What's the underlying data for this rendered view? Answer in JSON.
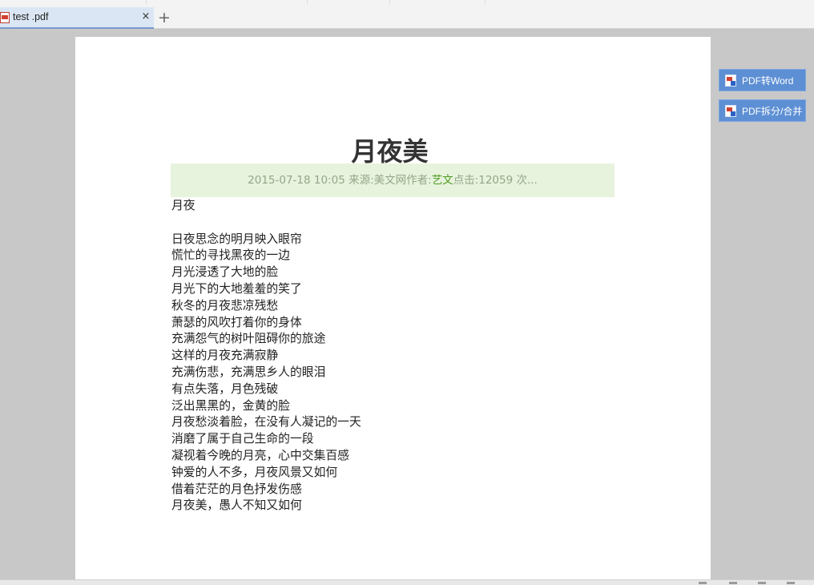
{
  "tabs": [
    {
      "title": "test .pdf",
      "close_glyph": "×",
      "icon": "pdf-file-icon"
    }
  ],
  "tabbar": {
    "add_glyph": "+"
  },
  "document": {
    "title": "月夜美",
    "meta": {
      "prefix": "2015-07-18 10:05 来源:美文网作者:",
      "author": "艺文",
      "suffix": "点击:12059 次..."
    },
    "lines": [
      "月夜",
      "",
      "日夜思念的明月映入眼帘",
      "慌忙的寻找黑夜的一边",
      "月光浸透了大地的脸",
      "月光下的大地羞羞的笑了",
      "秋冬的月夜悲凉残愁",
      "萧瑟的风吹打着你的身体",
      "充满怨气的树叶阻碍你的旅途",
      "这样的月夜充满寂静",
      "充满伤悲，充满思乡人的眼泪",
      "有点失落，月色残破",
      "泛出黑黑的，金黄的脸",
      "月夜愁淡着脸，在没有人凝记的一天",
      "消磨了属于自己生命的一段",
      "凝视着今晚的月亮，心中交集百感",
      "钟爱的人不多，月夜风景又如何",
      "借着茫茫的月色抒发伤感",
      "月夜美，愚人不知又如何"
    ]
  },
  "side_buttons": [
    {
      "label": "PDF转Word",
      "icon": "pdf-to-word-icon"
    },
    {
      "label": "PDF拆分/合并",
      "icon": "pdf-split-merge-icon"
    }
  ],
  "colors": {
    "meta_bg": "#e7f3dd",
    "author": "#4a9a1e",
    "side_button": "#5d8fd4"
  }
}
